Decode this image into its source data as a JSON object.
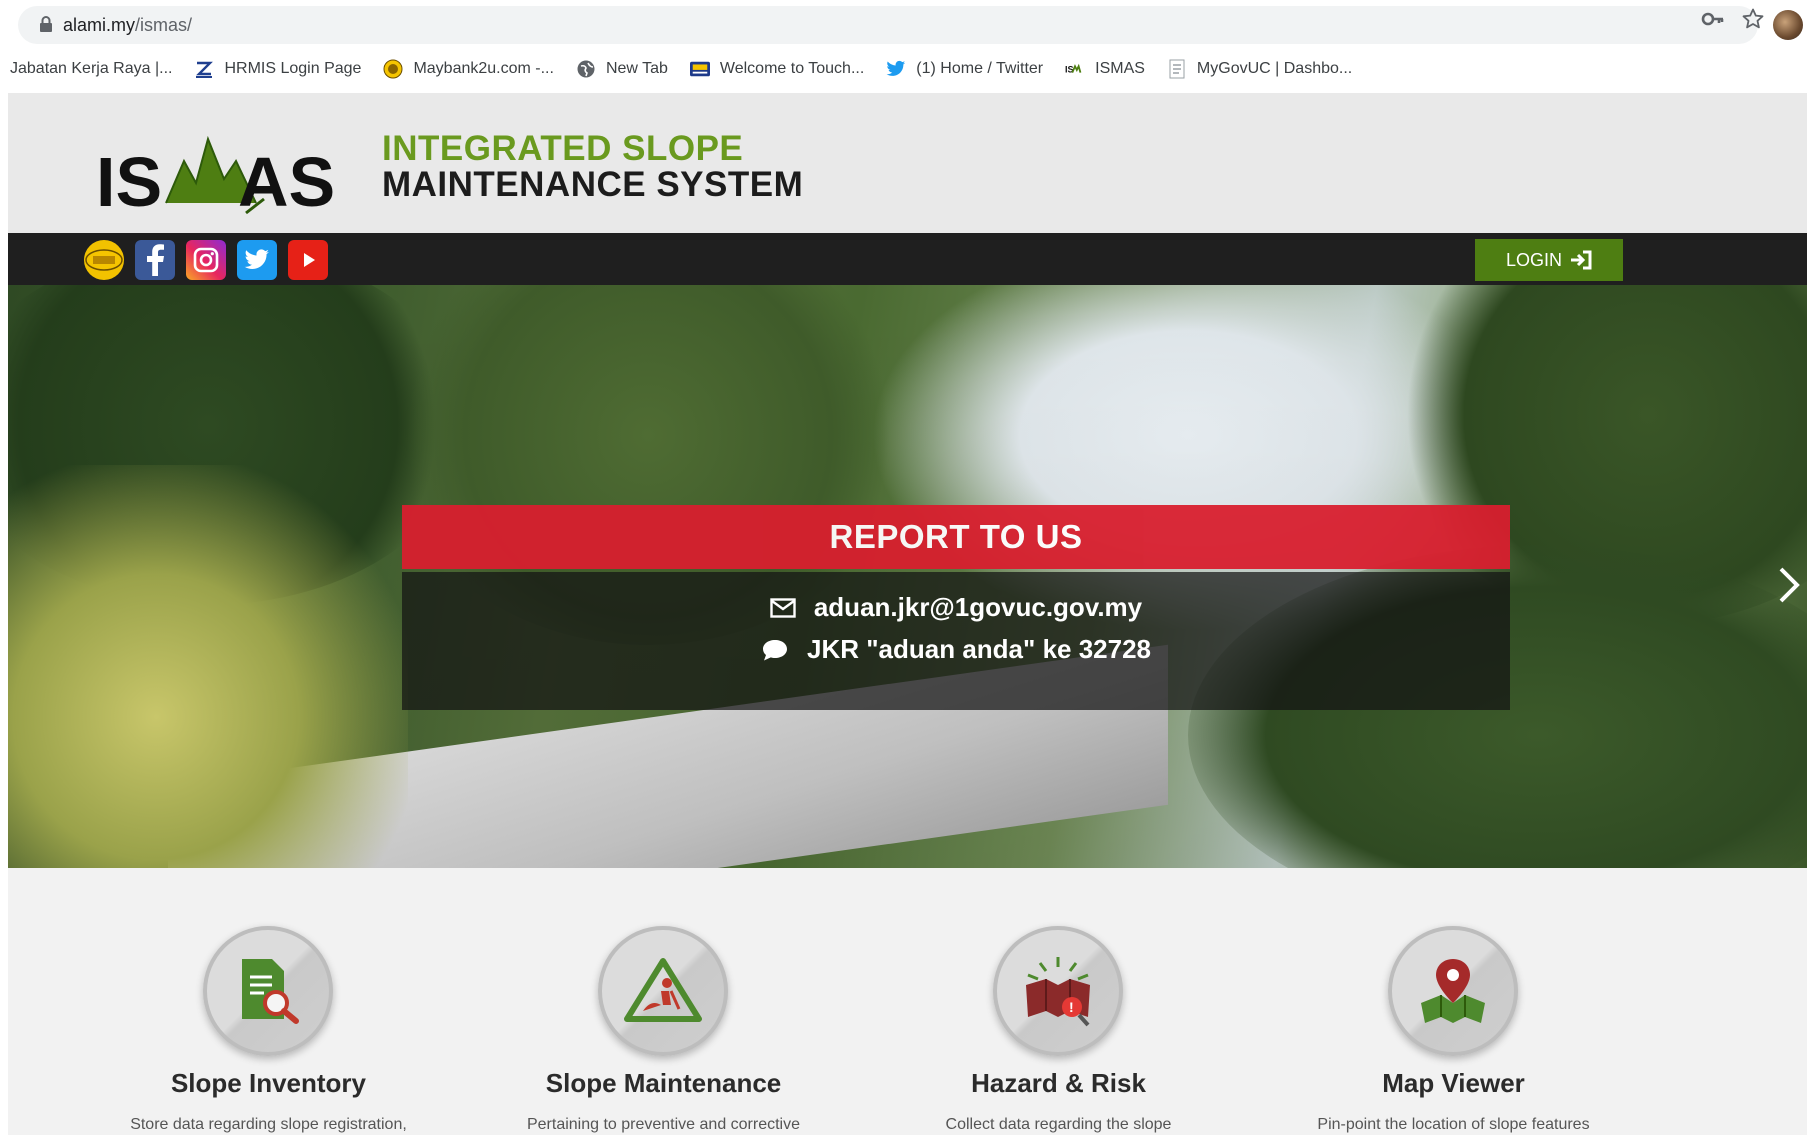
{
  "browser": {
    "url_host": "alami.my",
    "url_path": "/ismas/",
    "bookmarks": [
      {
        "label": "Jabatan Kerja Raya |...",
        "icon": "jkr-icon"
      },
      {
        "label": "HRMIS Login Page",
        "icon": "hrmis-icon"
      },
      {
        "label": "Maybank2u.com -...",
        "icon": "maybank-icon"
      },
      {
        "label": "New Tab",
        "icon": "globe-icon"
      },
      {
        "label": "Welcome to Touch...",
        "icon": "touchngo-icon"
      },
      {
        "label": "(1) Home / Twitter",
        "icon": "twitter-icon"
      },
      {
        "label": "ISMAS",
        "icon": "ismas-icon"
      },
      {
        "label": "MyGovUC | Dashbo...",
        "icon": "document-icon"
      }
    ]
  },
  "header": {
    "logo_text_left": "IS",
    "logo_text_right": "AS",
    "tagline_line1": "INTEGRATED SLOPE",
    "tagline_line2": "MAINTENANCE SYSTEM",
    "brand_green": "#6a9a1f"
  },
  "navbar": {
    "social": [
      "jkr-logo-icon",
      "facebook-icon",
      "instagram-icon",
      "twitter-icon",
      "youtube-icon"
    ],
    "login_label": "LOGIN",
    "login_color": "#4e7e12"
  },
  "hero": {
    "report_title": "REPORT TO US",
    "email": "aduan.jkr@1govuc.gov.my",
    "sms": "JKR \"aduan anda\" ke 32728",
    "report_color": "#d81f2e"
  },
  "features": [
    {
      "title": "Slope Inventory",
      "desc": "Store data regarding slope registration,",
      "icon": "document-search-icon"
    },
    {
      "title": "Slope Maintenance",
      "desc": "Pertaining to preventive and corrective",
      "icon": "worker-warning-icon"
    },
    {
      "title": "Hazard & Risk",
      "desc": "Collect data regarding the slope",
      "icon": "hazard-map-icon"
    },
    {
      "title": "Map Viewer",
      "desc": "Pin-point the location of slope features",
      "icon": "map-pin-icon"
    }
  ]
}
